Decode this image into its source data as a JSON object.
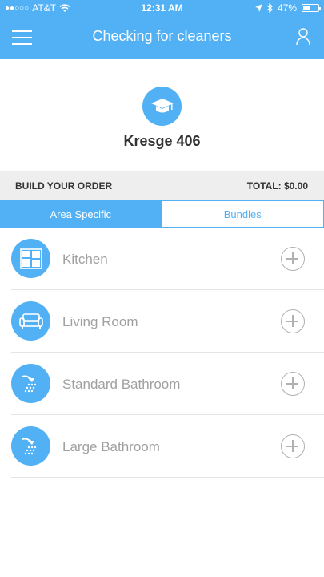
{
  "status_bar": {
    "signal": "●●○○○",
    "carrier": "AT&T",
    "time": "12:31 AM",
    "battery": "47%",
    "battery_level": 0.47
  },
  "nav": {
    "title": "Checking for cleaners",
    "menu_icon": "hamburger-icon",
    "profile_icon": "person-icon"
  },
  "location": {
    "name": "Kresge 406",
    "icon": "graduation-cap-icon"
  },
  "order": {
    "heading": "BUILD YOUR ORDER",
    "total": "TOTAL: $0.00"
  },
  "tabs": [
    {
      "label": "Area Specific",
      "active": true
    },
    {
      "label": "Bundles",
      "active": false
    }
  ],
  "areas": [
    {
      "label": "Kitchen",
      "icon": "kitchen-icon"
    },
    {
      "label": "Living Room",
      "icon": "sofa-icon"
    },
    {
      "label": "Standard Bathroom",
      "icon": "shower-icon"
    },
    {
      "label": "Large Bathroom",
      "icon": "shower-icon"
    }
  ],
  "colors": {
    "accent": "#52b1f5",
    "order_bar_bg": "#eeeeee",
    "muted_text": "#a0a0a0"
  }
}
